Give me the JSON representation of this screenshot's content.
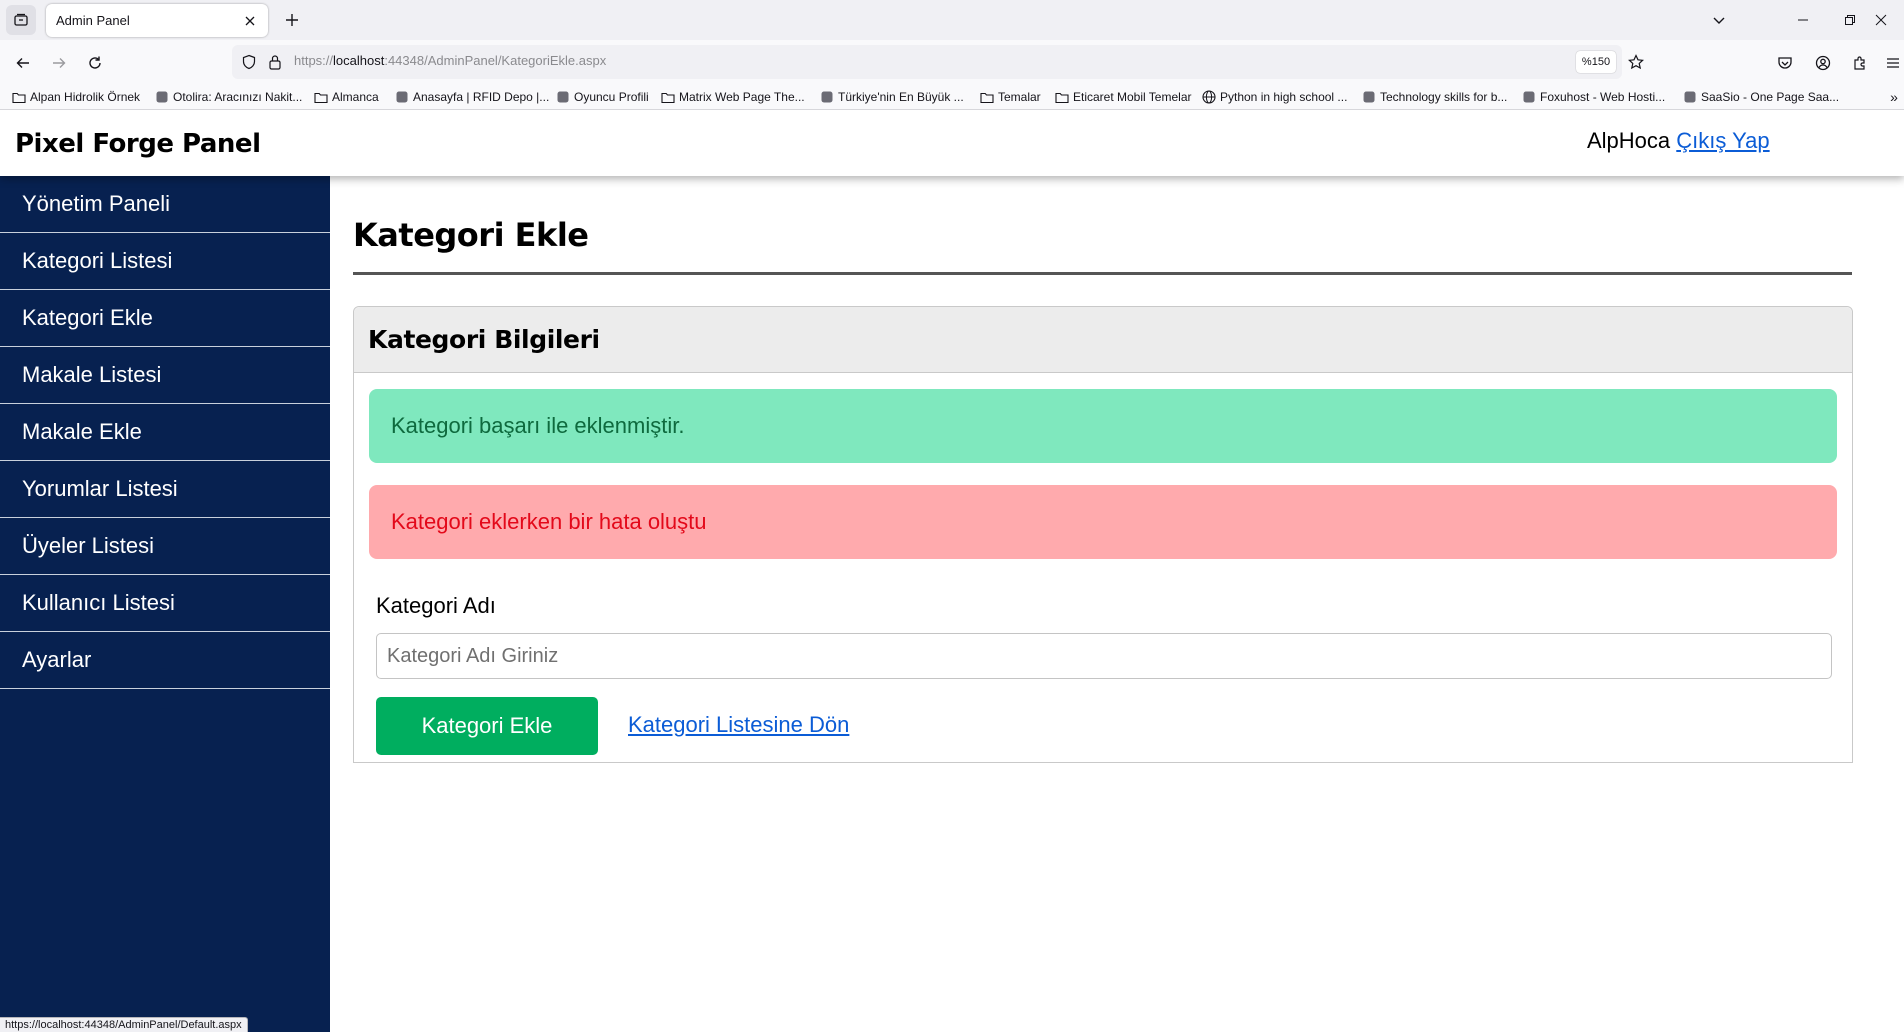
{
  "browser": {
    "tab_title": "Admin Panel",
    "url_prefix": "https://",
    "url_host": "localhost",
    "url_rest": ":44348/AdminPanel/KategoriEkle.aspx",
    "zoom": "%150",
    "status_url": "https://localhost:44348/AdminPanel/Default.aspx",
    "bookmarks": [
      {
        "label": "Alpan Hidrolik Örnek",
        "icon": "folder-icon"
      },
      {
        "label": "Otolira: Aracınızı Nakit...",
        "icon": "site-icon"
      },
      {
        "label": "Almanca",
        "icon": "folder-icon"
      },
      {
        "label": "Anasayfa | RFID Depo |...",
        "icon": "site-icon"
      },
      {
        "label": "Oyuncu Profili",
        "icon": "site-icon"
      },
      {
        "label": "Matrix Web Page The...",
        "icon": "folder-icon"
      },
      {
        "label": "Türkiye'nin En Büyük ...",
        "icon": "site-icon"
      },
      {
        "label": "Temalar",
        "icon": "folder-icon"
      },
      {
        "label": "Eticaret Mobil Temelar",
        "icon": "folder-icon"
      },
      {
        "label": "Python in high school ...",
        "icon": "globe-icon"
      },
      {
        "label": "Technology skills for b...",
        "icon": "site-icon"
      },
      {
        "label": "Foxuhost - Web Hosti...",
        "icon": "site-icon"
      },
      {
        "label": "SaaSio - One Page Saa...",
        "icon": "site-icon"
      }
    ]
  },
  "header": {
    "brand": "Pixel Forge Panel",
    "username": "AlpHoca",
    "logout_label": "Çıkış Yap"
  },
  "sidebar": {
    "items": [
      {
        "label": "Yönetim Paneli"
      },
      {
        "label": "Kategori Listesi"
      },
      {
        "label": "Kategori Ekle"
      },
      {
        "label": "Makale Listesi"
      },
      {
        "label": "Makale Ekle"
      },
      {
        "label": "Yorumlar Listesi"
      },
      {
        "label": "Üyeler Listesi"
      },
      {
        "label": "Kullanıcı Listesi"
      },
      {
        "label": "Ayarlar"
      }
    ]
  },
  "main": {
    "title": "Kategori Ekle",
    "card_title": "Kategori Bilgileri",
    "success_message": "Kategori başarı ile eklenmiştir.",
    "error_message": "Kategori eklerken bir hata oluştu",
    "field_label": "Kategori Adı",
    "field_placeholder": "Kategori Adı Giriniz",
    "field_value": "",
    "submit_label": "Kategori Ekle",
    "back_link_label": "Kategori Listesine Dön"
  },
  "colors": {
    "sidebar_bg": "#072150",
    "success_bg": "#7fe8be",
    "danger_bg": "#ffaaad",
    "danger_text": "#e3091a",
    "button_bg": "#00ae5f",
    "link": "#0b5cd6"
  }
}
